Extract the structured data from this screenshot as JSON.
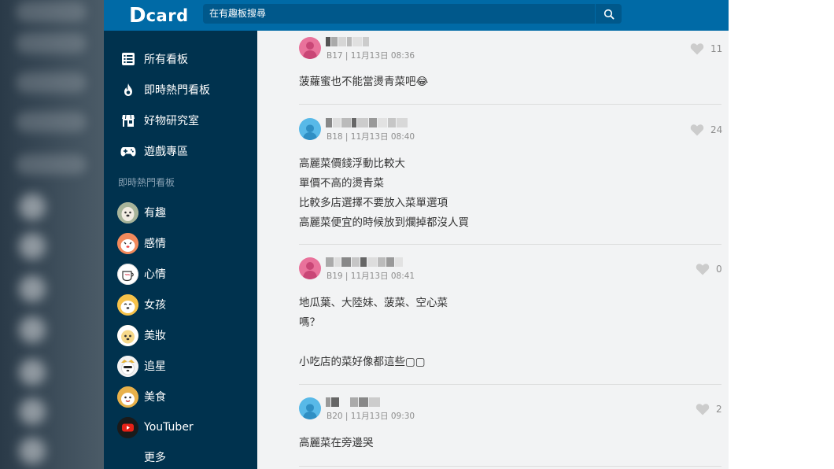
{
  "header": {
    "logo_letter": "D",
    "logo_text": "card",
    "search_placeholder": "在有趣板搜尋"
  },
  "sidebar": {
    "nav": [
      {
        "label": "所有看板",
        "icon": "list-icon"
      },
      {
        "label": "即時熱門看板",
        "icon": "flame-icon"
      },
      {
        "label": "好物研究室",
        "icon": "shop-icon"
      },
      {
        "label": "遊戲專區",
        "icon": "gamepad-icon"
      }
    ],
    "section_label": "即時熱門看板",
    "boards": [
      {
        "label": "有趣",
        "icon": "dog-avatar-icon",
        "color": "#d9d2c4"
      },
      {
        "label": "感情",
        "icon": "dog-avatar-icon",
        "color": "#f28a5c"
      },
      {
        "label": "心情",
        "icon": "cup-avatar-icon",
        "color": "#ffffff"
      },
      {
        "label": "女孩",
        "icon": "dog-avatar-icon",
        "color": "#f6c24a"
      },
      {
        "label": "美妝",
        "icon": "dog-avatar-icon",
        "color": "#f7d98a"
      },
      {
        "label": "追星",
        "icon": "dog-avatar-icon",
        "color": "#f3f3f3"
      },
      {
        "label": "美食",
        "icon": "dog-avatar-icon",
        "color": "#e8b14a"
      },
      {
        "label": "YouTuber",
        "icon": "youtube-icon",
        "color": "#1a1a1a"
      }
    ],
    "more_label": "更多"
  },
  "comments": [
    {
      "floor_time": "B17 | 11月13日 08:36",
      "likes": "11",
      "avatar": "pink",
      "lines": [
        "菠蘿蜜也不能當燙青菜吧😂"
      ]
    },
    {
      "floor_time": "B18 | 11月13日 08:40",
      "likes": "24",
      "avatar": "blue",
      "lines": [
        "高麗菜價錢浮動比較大",
        "單價不高的燙青菜",
        "比較多店選擇不要放入菜單選項",
        "高麗菜便宜的時候放到爛掉都沒人買"
      ]
    },
    {
      "floor_time": "B19 | 11月13日 08:41",
      "likes": "0",
      "avatar": "pink",
      "lines": [
        "地瓜葉、大陸妹、菠菜、空心菜",
        "嗎？",
        "",
        "小吃店的菜好像都這些▢▢"
      ]
    },
    {
      "floor_time": "B20 | 11月13日 09:30",
      "likes": "2",
      "avatar": "blue",
      "lines": [
        "高麗菜在旁邊哭"
      ]
    }
  ],
  "colors": {
    "header": "#006aa6",
    "sidebar": "#00324e",
    "main_bg": "#f2f3f4"
  }
}
